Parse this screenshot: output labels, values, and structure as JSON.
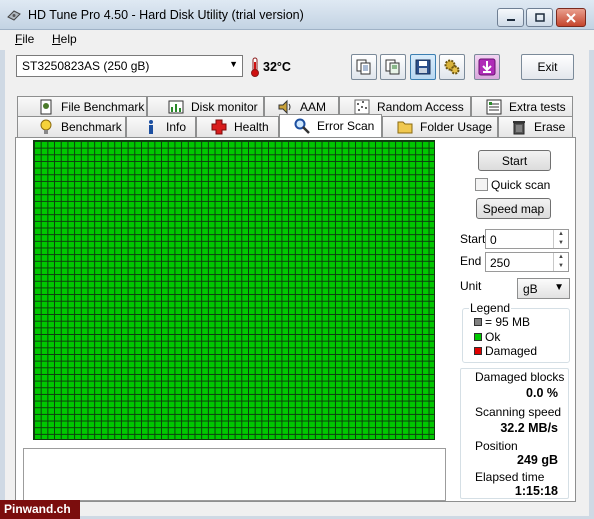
{
  "window": {
    "title": "HD Tune Pro 4.50 - Hard Disk Utility (trial version)"
  },
  "menu": {
    "file_first": "F",
    "file_rest": "ile",
    "help_first": "H",
    "help_rest": "elp"
  },
  "toolbar": {
    "drive": "ST3250823AS (250 gB)",
    "temperature": "32°C",
    "exit_label": "Exit"
  },
  "tabs_back": [
    {
      "label": "File Benchmark",
      "icon": "file-benchmark-icon"
    },
    {
      "label": "Disk monitor",
      "icon": "disk-monitor-icon"
    },
    {
      "label": "AAM",
      "icon": "speaker-icon"
    },
    {
      "label": "Random Access",
      "icon": "random-access-icon"
    },
    {
      "label": "Extra tests",
      "icon": "extra-tests-icon"
    }
  ],
  "tabs_front": [
    {
      "label": "Benchmark",
      "icon": "lightbulb-icon"
    },
    {
      "label": "Info",
      "icon": "info-icon"
    },
    {
      "label": "Health",
      "icon": "health-cross-icon"
    },
    {
      "label": "Error Scan",
      "icon": "magnifier-icon",
      "active": true
    },
    {
      "label": "Folder Usage",
      "icon": "folder-icon"
    },
    {
      "label": "Erase",
      "icon": "trash-icon"
    }
  ],
  "scan": {
    "start_button": "Start",
    "quick_scan_label": "Quick scan",
    "quick_scan_checked": false,
    "speed_map_button": "Speed map",
    "start_label": "Start",
    "start_value": "0",
    "end_label": "End",
    "end_value": "250",
    "unit_label": "Unit",
    "unit_value": "gB",
    "grid_color": "#00c800"
  },
  "legend": {
    "title": "Legend",
    "items": [
      {
        "label": "= 95 MB",
        "color": "#808080"
      },
      {
        "label": "Ok",
        "color": "#00c800"
      },
      {
        "label": "Damaged",
        "color": "#e00000"
      }
    ]
  },
  "stats": {
    "damaged_blocks_label": "Damaged blocks",
    "damaged_blocks_value": "0.0 %",
    "scanning_speed_label": "Scanning speed",
    "scanning_speed_value": "32.2 MB/s",
    "position_label": "Position",
    "position_value": "249 gB",
    "elapsed_label": "Elapsed time",
    "elapsed_value": "1:15:18"
  },
  "watermark": "Pinwand.ch"
}
